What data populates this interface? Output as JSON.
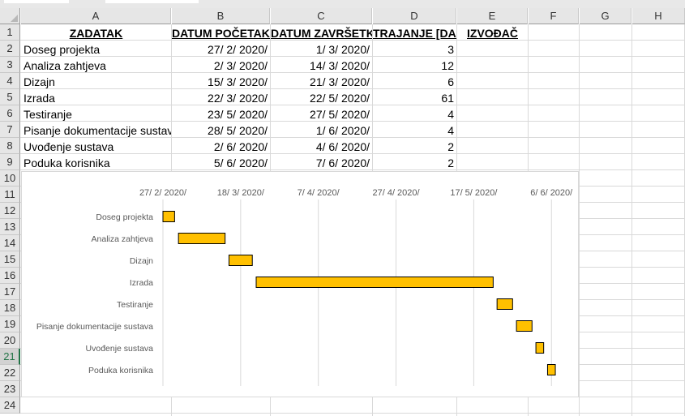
{
  "columns": [
    "A",
    "B",
    "C",
    "D",
    "E",
    "F",
    "G",
    "H"
  ],
  "rows": [
    "1",
    "2",
    "3",
    "4",
    "5",
    "6",
    "7",
    "8",
    "9",
    "10",
    "11",
    "12",
    "13",
    "14",
    "15",
    "16",
    "17",
    "18",
    "19",
    "20",
    "21",
    "22",
    "23",
    "24"
  ],
  "selected_row": "21",
  "headers": {
    "zadatak": "ZADATAK",
    "datum_pocetka": "DATUM POČETAKA",
    "datum_zavrsetka": "DATUM ZAVRŠETKA",
    "trajanje": "TRAJANJE [DAN]",
    "izvodac": "IZVOĐAČ"
  },
  "tasks": [
    {
      "name": "Doseg projekta",
      "start": "27/ 2/ 2020/",
      "end": "1/ 3/ 2020/",
      "duration": "3"
    },
    {
      "name": "Analiza zahtjeva",
      "start": "2/ 3/ 2020/",
      "end": "14/ 3/ 2020/",
      "duration": "12"
    },
    {
      "name": "Dizajn",
      "start": "15/ 3/ 2020/",
      "end": "21/ 3/ 2020/",
      "duration": "6"
    },
    {
      "name": "Izrada",
      "start": "22/ 3/ 2020/",
      "end": "22/ 5/ 2020/",
      "duration": "61"
    },
    {
      "name": "Testiranje",
      "start": "23/ 5/ 2020/",
      "end": "27/ 5/ 2020/",
      "duration": "4"
    },
    {
      "name": "Pisanje dokumentacije sustava",
      "start": "28/ 5/ 2020/",
      "end": "1/ 6/ 2020/",
      "duration": "4"
    },
    {
      "name": "Uvođenje sustava",
      "start": "2/ 6/ 2020/",
      "end": "4/ 6/ 2020/",
      "duration": "2"
    },
    {
      "name": "Poduka korisnika",
      "start": "5/ 6/ 2020/",
      "end": "7/ 6/ 2020/",
      "duration": "2"
    }
  ],
  "chart_data": {
    "type": "bar",
    "orientation": "horizontal-gantt",
    "categories": [
      "Doseg projekta",
      "Analiza zahtjeva",
      "Dizajn",
      "Izrada",
      "Testiranje",
      "Pisanje dokumentacije sustava",
      "Uvođenje sustava",
      "Poduka korisnika"
    ],
    "x_tick_labels": [
      "27/ 2/ 2020/",
      "18/ 3/ 2020/",
      "7/ 4/ 2020/",
      "27/ 4/ 2020/",
      "17/ 5/ 2020/",
      "6/ 6/ 2020/"
    ],
    "x_ticks": [
      "2020-02-27",
      "2020-03-18",
      "2020-04-07",
      "2020-04-27",
      "2020-05-17",
      "2020-06-06"
    ],
    "series": [
      {
        "values_start": [
          "2020-02-27",
          "2020-03-02",
          "2020-03-15",
          "2020-03-22",
          "2020-05-23",
          "2020-05-28",
          "2020-06-02",
          "2020-06-05"
        ],
        "values_duration": [
          3,
          12,
          6,
          61,
          4,
          4,
          2,
          2
        ]
      }
    ],
    "xlim": [
      "2020-02-27",
      "2020-06-12"
    ],
    "x_axis_position": "top",
    "grid": true,
    "bar_color": "#ffc000",
    "bar_border": "#000000",
    "legend": "none"
  }
}
